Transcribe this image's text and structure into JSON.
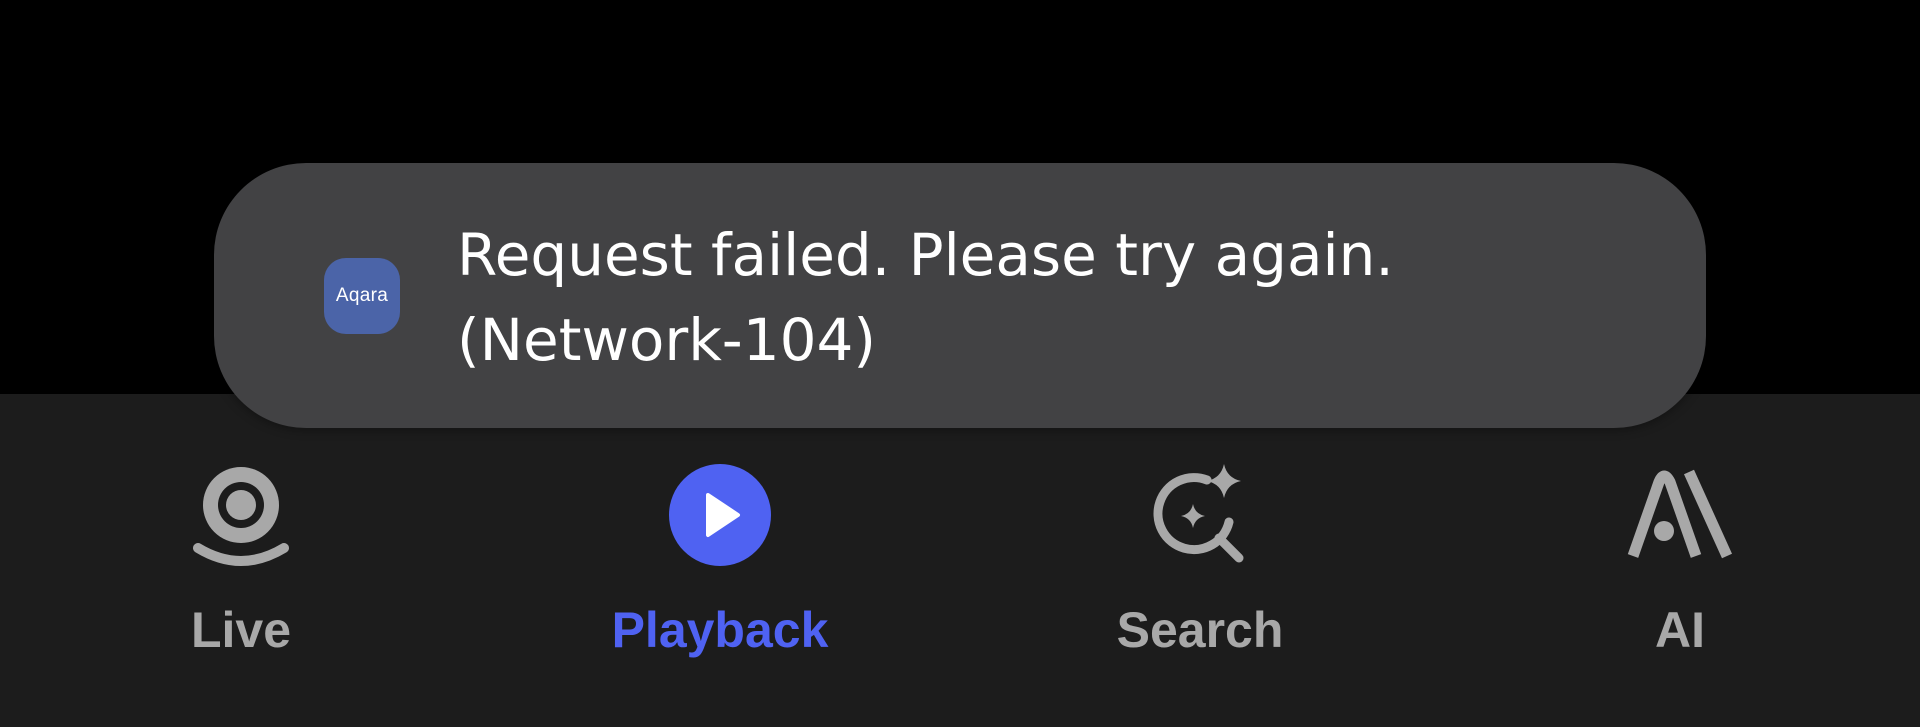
{
  "toast": {
    "app_icon_label": "Aqara",
    "message_line1": "Request failed. Please try again.",
    "message_line2": "(Network-104)"
  },
  "tabs": [
    {
      "label": "Live",
      "icon": "camera-icon",
      "active": false
    },
    {
      "label": "Playback",
      "icon": "play-icon",
      "active": true
    },
    {
      "label": "Search",
      "icon": "sparkle-search-icon",
      "active": false
    },
    {
      "label": "AI",
      "icon": "ai-icon",
      "active": false
    }
  ],
  "colors": {
    "background": "#000000",
    "tab_bar": "#1c1c1c",
    "toast": "#424244",
    "accent": "#4f62f2",
    "inactive": "#a8a8a8",
    "app_icon": "#4b64a8"
  }
}
